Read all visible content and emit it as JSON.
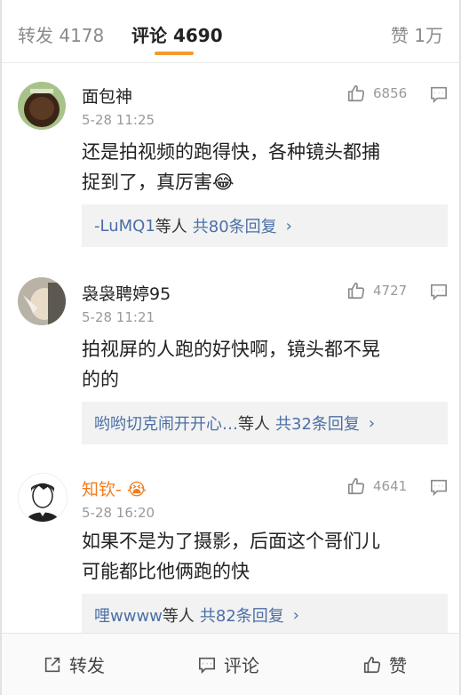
{
  "tabs": {
    "repost": "转发 4178",
    "comment": "评论 4690",
    "like": "赞 1万"
  },
  "comments": [
    {
      "username": "面包神",
      "time": "5-28 11:25",
      "likes": "6856",
      "text_lines": [
        "还是拍视频的跑得快，各种镜头都捕",
        "捉到了，真厉害"
      ],
      "emoji": "😂",
      "replies_prefix": "-LuMQ1",
      "replies_suffix": "等人",
      "replies_total": "共80条回复"
    },
    {
      "username": "袅袅聘婷95",
      "time": "5-28 11:21",
      "likes": "4727",
      "text_lines": [
        "拍视屏的人跑的好快啊，镜头都不晃",
        "的的"
      ],
      "replies_prefix": "哟哟切克闹开开心…",
      "replies_suffix": "等人",
      "replies_total": "共32条回复"
    },
    {
      "username": "知钦-",
      "badge": "😭",
      "time": "5-28 16:20",
      "likes": "4641",
      "text_lines": [
        "如果不是为了摄影，后面这个哥们儿",
        "可能都比他俩跑的快"
      ],
      "replies_prefix": "哩wwww",
      "replies_suffix": "等人",
      "replies_total": "共82条回复"
    }
  ],
  "bottom": {
    "repost": "转发",
    "comment": "评论",
    "like": "赞"
  },
  "colors": {
    "accent": "#f39a2e",
    "link": "#4b6fa6",
    "vip_name": "#f07b1d"
  }
}
